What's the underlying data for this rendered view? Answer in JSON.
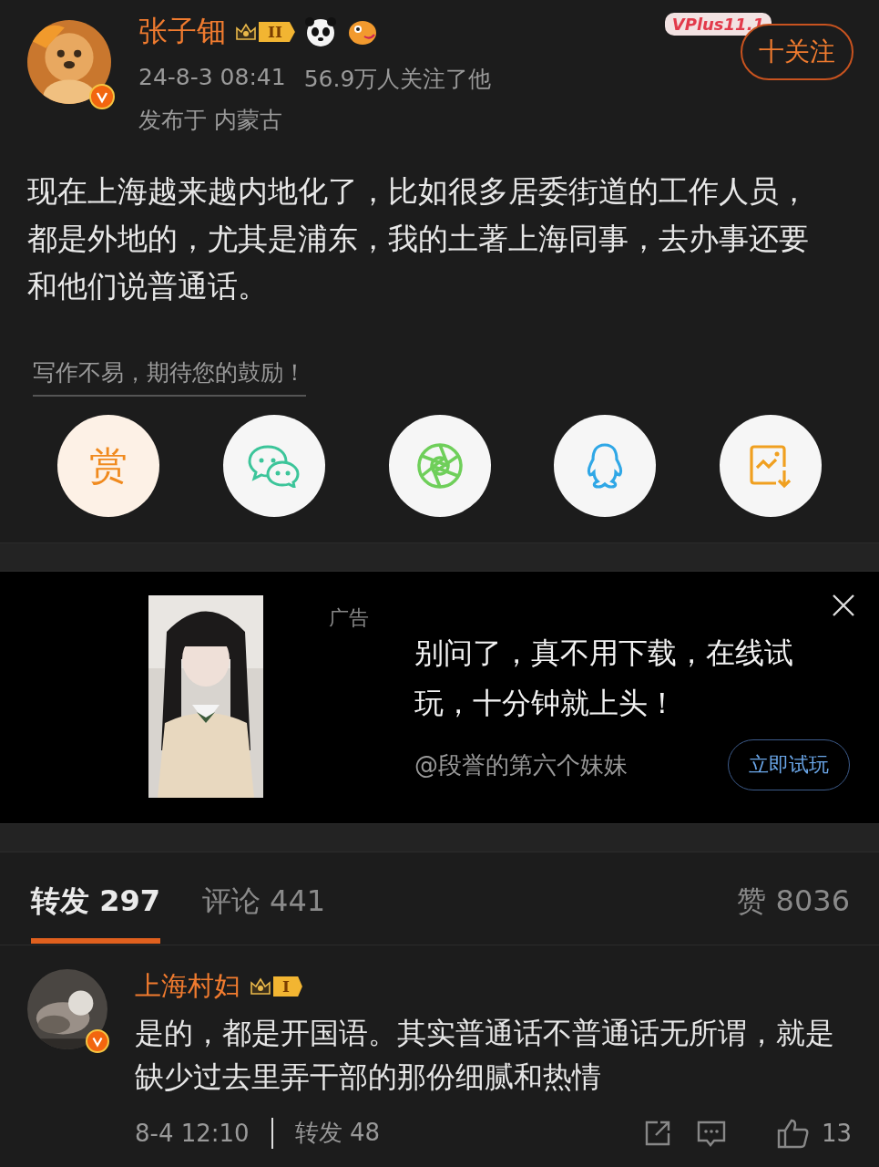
{
  "post": {
    "author": "张子钿",
    "level_badge": "II",
    "promo_badge": "VPlus11.1",
    "follow_button": "十关注",
    "time": "24-8-3 08:41",
    "followers": "56.9万人关注了他",
    "location": "发布于 内蒙古",
    "verified": true,
    "text": "现在上海越来越内地化了，比如很多居委街道的工作人员，都是外地的，尤其是浦东，我的土著上海同事，去办事还要和他们说普通话。"
  },
  "reward_hint": "写作不易，期待您的鼓励！",
  "share_buttons": [
    {
      "kind": "reward",
      "label": "赏"
    },
    {
      "kind": "wechat"
    },
    {
      "kind": "moments"
    },
    {
      "kind": "qq"
    },
    {
      "kind": "save-image"
    }
  ],
  "ad": {
    "tag": "广告",
    "headline": "别问了，真不用下载，在线试玩，十分钟就上头！",
    "advertiser": "@段誉的第六个妹妹",
    "cta": "立即试玩"
  },
  "tabs": [
    {
      "label": "转发 297",
      "selected": true
    },
    {
      "label": "评论 441",
      "selected": false
    },
    {
      "label": "赞 8036",
      "selected": false
    }
  ],
  "comments": [
    {
      "author": "上海村妇",
      "level_badge": "I",
      "verified": true,
      "text": "是的，都是开国语。其实普通话不普通话无所谓，就是缺少过去里弄干部的那份细腻和热情",
      "time": "8-4 12:10",
      "reposts": "转发 48",
      "likes": "13"
    }
  ]
}
